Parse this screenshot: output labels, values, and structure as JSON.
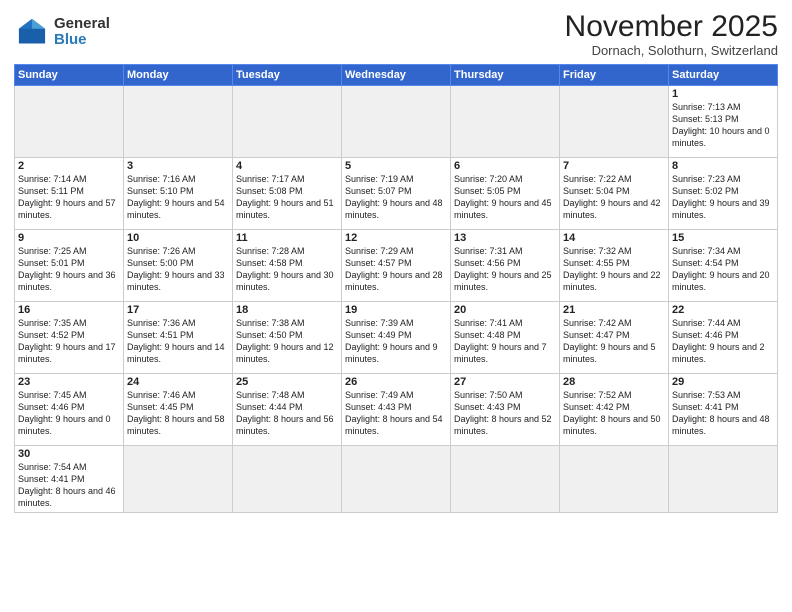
{
  "header": {
    "logo_general": "General",
    "logo_blue": "Blue",
    "month_title": "November 2025",
    "location": "Dornach, Solothurn, Switzerland"
  },
  "weekdays": [
    "Sunday",
    "Monday",
    "Tuesday",
    "Wednesday",
    "Thursday",
    "Friday",
    "Saturday"
  ],
  "weeks": [
    [
      {
        "day": "",
        "info": ""
      },
      {
        "day": "",
        "info": ""
      },
      {
        "day": "",
        "info": ""
      },
      {
        "day": "",
        "info": ""
      },
      {
        "day": "",
        "info": ""
      },
      {
        "day": "",
        "info": ""
      },
      {
        "day": "1",
        "info": "Sunrise: 7:13 AM\nSunset: 5:13 PM\nDaylight: 10 hours and 0 minutes."
      }
    ],
    [
      {
        "day": "2",
        "info": "Sunrise: 7:14 AM\nSunset: 5:11 PM\nDaylight: 9 hours and 57 minutes."
      },
      {
        "day": "3",
        "info": "Sunrise: 7:16 AM\nSunset: 5:10 PM\nDaylight: 9 hours and 54 minutes."
      },
      {
        "day": "4",
        "info": "Sunrise: 7:17 AM\nSunset: 5:08 PM\nDaylight: 9 hours and 51 minutes."
      },
      {
        "day": "5",
        "info": "Sunrise: 7:19 AM\nSunset: 5:07 PM\nDaylight: 9 hours and 48 minutes."
      },
      {
        "day": "6",
        "info": "Sunrise: 7:20 AM\nSunset: 5:05 PM\nDaylight: 9 hours and 45 minutes."
      },
      {
        "day": "7",
        "info": "Sunrise: 7:22 AM\nSunset: 5:04 PM\nDaylight: 9 hours and 42 minutes."
      },
      {
        "day": "8",
        "info": "Sunrise: 7:23 AM\nSunset: 5:02 PM\nDaylight: 9 hours and 39 minutes."
      }
    ],
    [
      {
        "day": "9",
        "info": "Sunrise: 7:25 AM\nSunset: 5:01 PM\nDaylight: 9 hours and 36 minutes."
      },
      {
        "day": "10",
        "info": "Sunrise: 7:26 AM\nSunset: 5:00 PM\nDaylight: 9 hours and 33 minutes."
      },
      {
        "day": "11",
        "info": "Sunrise: 7:28 AM\nSunset: 4:58 PM\nDaylight: 9 hours and 30 minutes."
      },
      {
        "day": "12",
        "info": "Sunrise: 7:29 AM\nSunset: 4:57 PM\nDaylight: 9 hours and 28 minutes."
      },
      {
        "day": "13",
        "info": "Sunrise: 7:31 AM\nSunset: 4:56 PM\nDaylight: 9 hours and 25 minutes."
      },
      {
        "day": "14",
        "info": "Sunrise: 7:32 AM\nSunset: 4:55 PM\nDaylight: 9 hours and 22 minutes."
      },
      {
        "day": "15",
        "info": "Sunrise: 7:34 AM\nSunset: 4:54 PM\nDaylight: 9 hours and 20 minutes."
      }
    ],
    [
      {
        "day": "16",
        "info": "Sunrise: 7:35 AM\nSunset: 4:52 PM\nDaylight: 9 hours and 17 minutes."
      },
      {
        "day": "17",
        "info": "Sunrise: 7:36 AM\nSunset: 4:51 PM\nDaylight: 9 hours and 14 minutes."
      },
      {
        "day": "18",
        "info": "Sunrise: 7:38 AM\nSunset: 4:50 PM\nDaylight: 9 hours and 12 minutes."
      },
      {
        "day": "19",
        "info": "Sunrise: 7:39 AM\nSunset: 4:49 PM\nDaylight: 9 hours and 9 minutes."
      },
      {
        "day": "20",
        "info": "Sunrise: 7:41 AM\nSunset: 4:48 PM\nDaylight: 9 hours and 7 minutes."
      },
      {
        "day": "21",
        "info": "Sunrise: 7:42 AM\nSunset: 4:47 PM\nDaylight: 9 hours and 5 minutes."
      },
      {
        "day": "22",
        "info": "Sunrise: 7:44 AM\nSunset: 4:46 PM\nDaylight: 9 hours and 2 minutes."
      }
    ],
    [
      {
        "day": "23",
        "info": "Sunrise: 7:45 AM\nSunset: 4:46 PM\nDaylight: 9 hours and 0 minutes."
      },
      {
        "day": "24",
        "info": "Sunrise: 7:46 AM\nSunset: 4:45 PM\nDaylight: 8 hours and 58 minutes."
      },
      {
        "day": "25",
        "info": "Sunrise: 7:48 AM\nSunset: 4:44 PM\nDaylight: 8 hours and 56 minutes."
      },
      {
        "day": "26",
        "info": "Sunrise: 7:49 AM\nSunset: 4:43 PM\nDaylight: 8 hours and 54 minutes."
      },
      {
        "day": "27",
        "info": "Sunrise: 7:50 AM\nSunset: 4:43 PM\nDaylight: 8 hours and 52 minutes."
      },
      {
        "day": "28",
        "info": "Sunrise: 7:52 AM\nSunset: 4:42 PM\nDaylight: 8 hours and 50 minutes."
      },
      {
        "day": "29",
        "info": "Sunrise: 7:53 AM\nSunset: 4:41 PM\nDaylight: 8 hours and 48 minutes."
      }
    ],
    [
      {
        "day": "30",
        "info": "Sunrise: 7:54 AM\nSunset: 4:41 PM\nDaylight: 8 hours and 46 minutes."
      },
      {
        "day": "",
        "info": ""
      },
      {
        "day": "",
        "info": ""
      },
      {
        "day": "",
        "info": ""
      },
      {
        "day": "",
        "info": ""
      },
      {
        "day": "",
        "info": ""
      },
      {
        "day": "",
        "info": ""
      }
    ]
  ]
}
